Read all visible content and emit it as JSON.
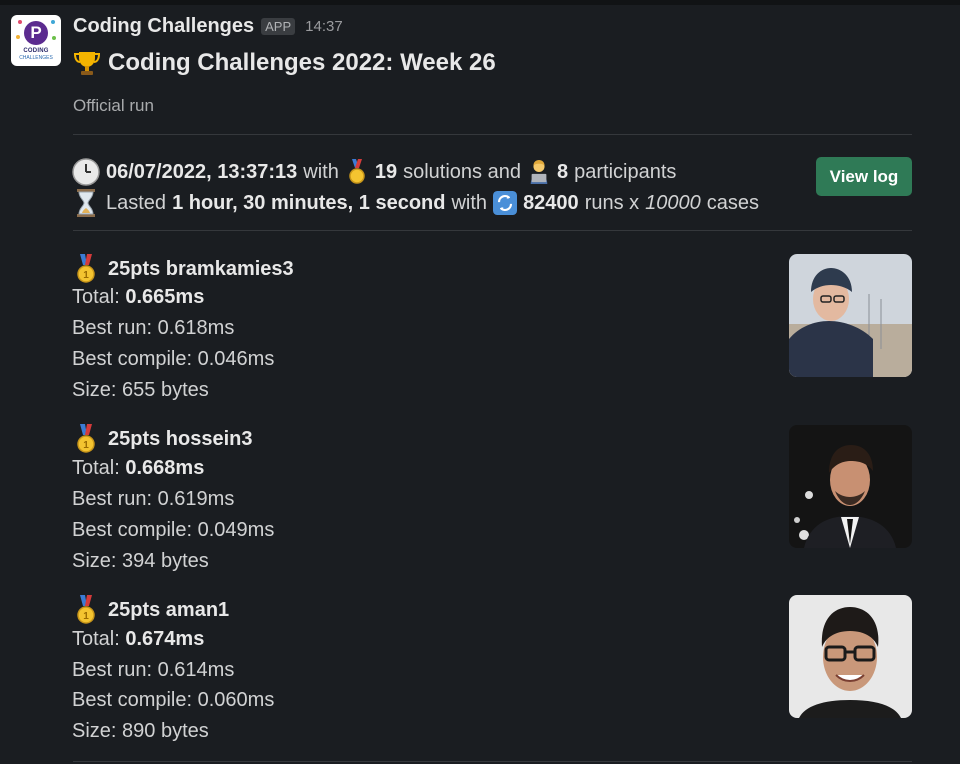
{
  "app": {
    "name": "Coding Challenges",
    "badge": "APP",
    "time": "14:37",
    "logo_line1": "CODING",
    "logo_line2": "CHALLENGES"
  },
  "message": {
    "title": "Coding Challenges 2022: Week 26",
    "subtitle": "Official run",
    "date": "06/07/2022, 13:37:13",
    "with_1": "with",
    "solutions_count": "19",
    "solutions_and": "solutions and",
    "participants_count": "8",
    "participants_label": "participants",
    "lasted_label": "Lasted",
    "duration": "1 hour, 30 minutes, 1 second",
    "with_2": "with",
    "runs_count": "82400",
    "runs_x": "runs x",
    "cases_count": "10000",
    "cases_label": "cases",
    "view_log": "View log"
  },
  "labels": {
    "total": "Total:",
    "best_run": "Best run:",
    "best_compile": "Best compile:",
    "size": "Size:"
  },
  "entries": [
    {
      "pts_user": "25pts bramkamies3",
      "total": "0.665ms",
      "best_run": "0.618ms",
      "best_compile": "0.046ms",
      "size": "655 bytes"
    },
    {
      "pts_user": "25pts hossein3",
      "total": "0.668ms",
      "best_run": "0.619ms",
      "best_compile": "0.049ms",
      "size": "394 bytes"
    },
    {
      "pts_user": "25pts aman1",
      "total": "0.674ms",
      "best_run": "0.614ms",
      "best_compile": "0.060ms",
      "size": "890 bytes"
    }
  ],
  "icons": {
    "app_logo": "coding-challenges-logo",
    "title": "trophy-icon",
    "date": "clock-icon",
    "solutions": "medal-icon",
    "participants": "technologist-icon",
    "duration": "hourglass-icon",
    "runs": "repeat-icon",
    "entry": "gold-medal-icon"
  },
  "colors": {
    "background": "#1a1d21",
    "accent_button": "#2f7a56",
    "text": "#d1d2d3"
  }
}
